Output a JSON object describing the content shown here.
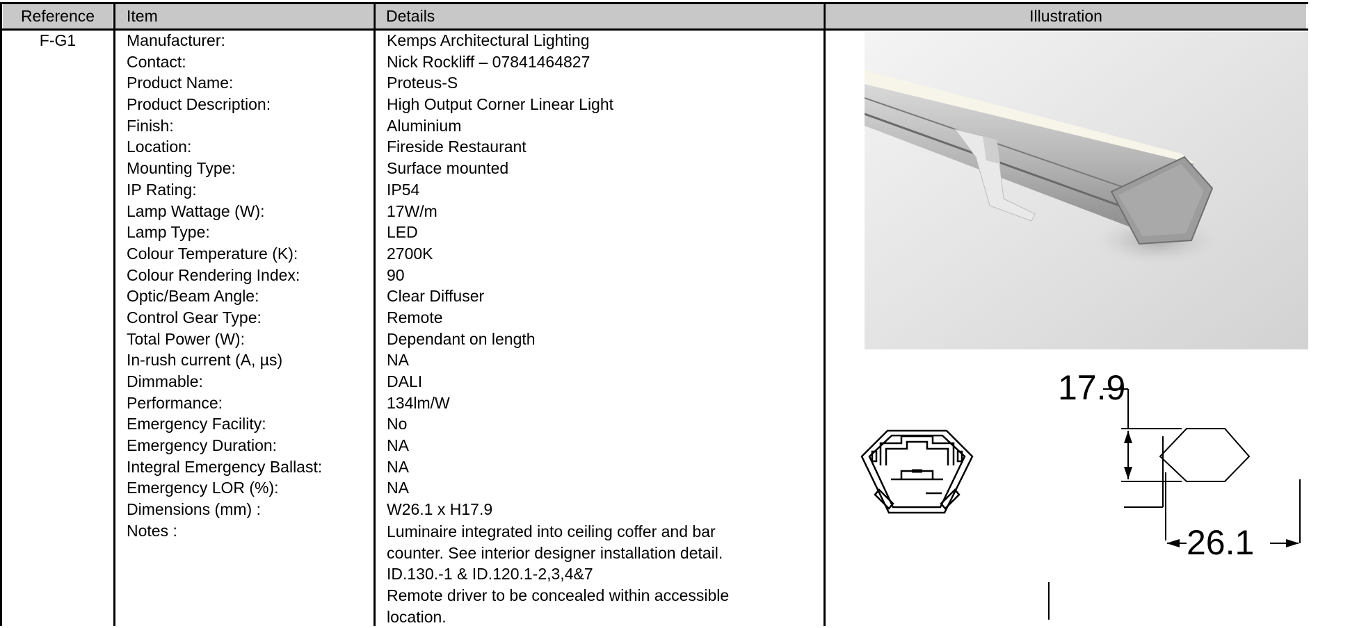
{
  "table": {
    "headers": {
      "reference": "Reference",
      "item": "Item",
      "details": "Details",
      "illustration": "Illustration"
    },
    "reference": "F-G1",
    "rows": [
      {
        "item": "Manufacturer:",
        "detail": "Kemps Architectural Lighting"
      },
      {
        "item": "Contact:",
        "detail": "Nick Rockliff – 07841464827"
      },
      {
        "item": "Product Name:",
        "detail": "Proteus-S"
      },
      {
        "item": "Product Description:",
        "detail": "High Output Corner Linear Light"
      },
      {
        "item": "Finish:",
        "detail": "Aluminium"
      },
      {
        "item": "Location:",
        "detail": "Fireside Restaurant"
      },
      {
        "item": "Mounting Type:",
        "detail": "Surface mounted"
      },
      {
        "item": "IP Rating:",
        "detail": "IP54"
      },
      {
        "item": "Lamp Wattage (W):",
        "detail": "17W/m"
      },
      {
        "item": "Lamp Type:",
        "detail": "LED"
      },
      {
        "item": "Colour Temperature (K):",
        "detail": "2700K"
      },
      {
        "item": "Colour Rendering Index:",
        "detail": "90"
      },
      {
        "item": "Optic/Beam Angle:",
        "detail": "Clear Diffuser"
      },
      {
        "item": "Control Gear Type:",
        "detail": "Remote"
      },
      {
        "item": "Total Power (W):",
        "detail": "Dependant on length"
      },
      {
        "item": "In-rush current (A, µs)",
        "detail": "NA"
      },
      {
        "item": "Dimmable:",
        "detail": "DALI"
      },
      {
        "item": "Performance:",
        "detail": "134lm/W"
      },
      {
        "item": "Emergency Facility:",
        "detail": "No"
      },
      {
        "item": "Emergency Duration:",
        "detail": "NA"
      },
      {
        "item": "Integral Emergency Ballast:",
        "detail": "NA"
      },
      {
        "item": "Emergency LOR (%):",
        "detail": "NA"
      },
      {
        "item": "Dimensions (mm) :",
        "detail": "W26.1 x H17.9"
      },
      {
        "item": "Notes :",
        "detail": ""
      }
    ],
    "notes": [
      "Luminaire integrated into ceiling coffer and bar",
      "counter. See interior designer installation detail.",
      "ID.130.-1 & ID.120.1-2,3,4&7",
      "Remote driver to be concealed within accessible",
      "location."
    ]
  },
  "drawing": {
    "height_label": "17.9",
    "width_label": "26.1"
  },
  "colors": {
    "header_bg": "#c8c8c8",
    "photo_bg": "#e4e4e4"
  }
}
